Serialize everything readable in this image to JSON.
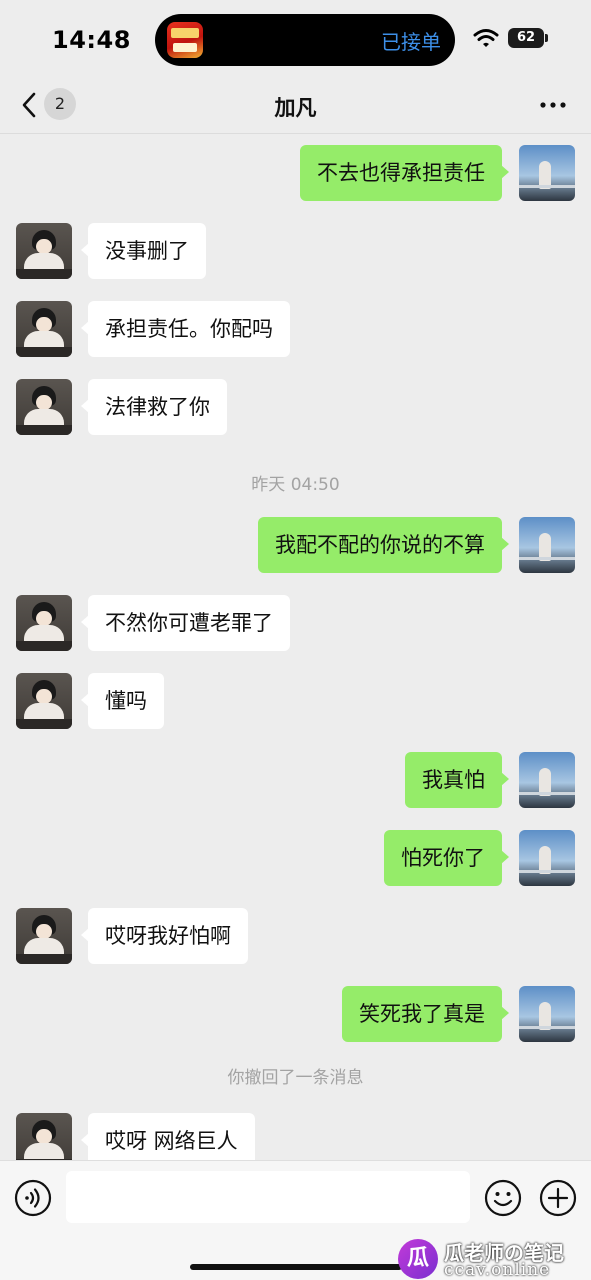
{
  "status_bar": {
    "time": "14:48",
    "island_app_icon": "shopping-app-icon",
    "island_status": "已接单",
    "battery": "62",
    "icons": [
      "wifi-icon",
      "battery-icon"
    ]
  },
  "nav": {
    "back_icon": "chevron-left-icon",
    "unread_count": "2",
    "title": "加凡",
    "more_icon": "more-dots-icon"
  },
  "messages": [
    {
      "from": "me",
      "text": "不去也得承担责任"
    },
    {
      "from": "other",
      "text": "没事删了"
    },
    {
      "from": "other",
      "text": "承担责任。你配吗"
    },
    {
      "from": "other",
      "text": "法律救了你"
    },
    {
      "type": "time",
      "text": "昨天 04:50"
    },
    {
      "from": "me",
      "text": "我配不配的你说的不算"
    },
    {
      "from": "other",
      "text": "不然你可遭老罪了"
    },
    {
      "from": "other",
      "text": "懂吗"
    },
    {
      "from": "me",
      "text": "我真怕"
    },
    {
      "from": "me",
      "text": "怕死你了"
    },
    {
      "from": "other",
      "text": "哎呀我好怕啊"
    },
    {
      "from": "me",
      "text": "笑死我了真是"
    },
    {
      "type": "system",
      "text": "你撤回了一条消息"
    },
    {
      "from": "other",
      "text": "哎呀 网络巨人"
    }
  ],
  "input_bar": {
    "voice_icon": "voice-icon",
    "input_value": "",
    "emoji_icon": "emoji-icon",
    "plus_icon": "plus-icon"
  },
  "watermark": {
    "logo_char": "瓜",
    "title": "瓜老师の笔记",
    "url": "ccav.online"
  },
  "colors": {
    "background": "#ededed",
    "outgoing_bubble": "#95ec69",
    "incoming_bubble": "#ffffff",
    "island_status": "#3d8fe8"
  }
}
